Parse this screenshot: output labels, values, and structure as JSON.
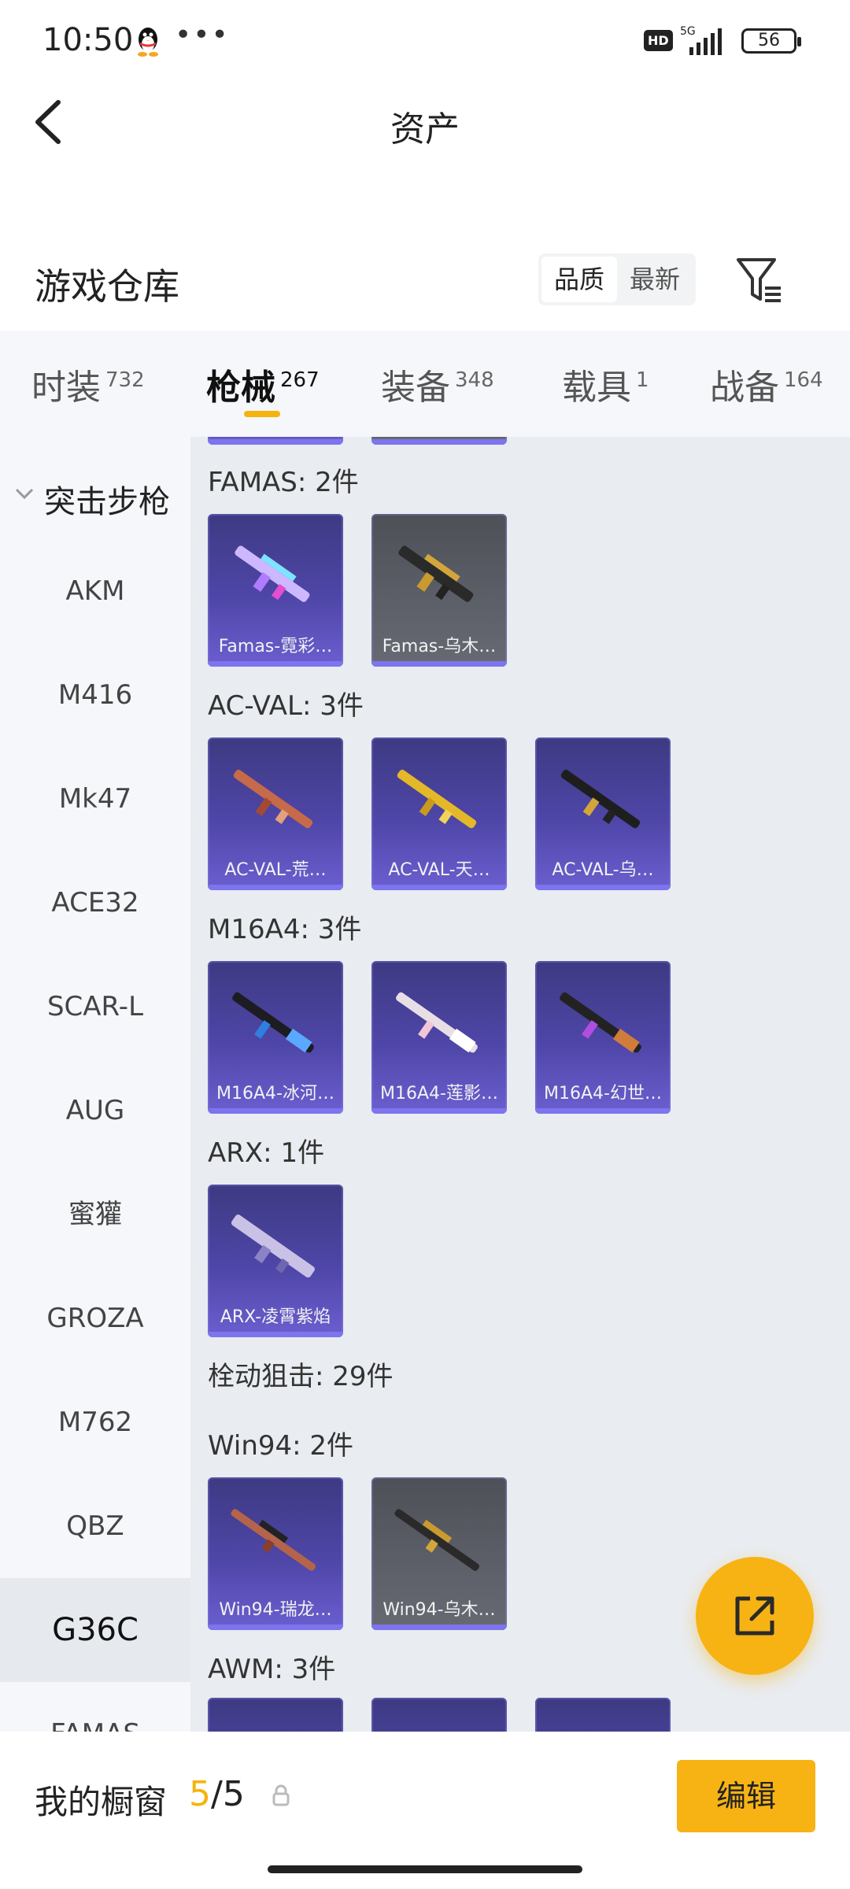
{
  "status_bar": {
    "time": "10:50",
    "network": "5G",
    "hd": "HD",
    "battery": "56",
    "dots": "•••"
  },
  "nav": {
    "title": "资产"
  },
  "warehouse": {
    "title": "游戏仓库",
    "sort_options": [
      "品质",
      "最新"
    ],
    "active_sort": "品质"
  },
  "tabs": [
    {
      "label": "时装",
      "count": "732"
    },
    {
      "label": "枪械",
      "count": "267"
    },
    {
      "label": "装备",
      "count": "348"
    },
    {
      "label": "载具",
      "count": "1"
    },
    {
      "label": "战备",
      "count": "164"
    }
  ],
  "sidebar": {
    "category": "突击步枪",
    "items": [
      "AKM",
      "M416",
      "Mk47",
      "ACE32",
      "SCAR-L",
      "AUG",
      "蜜獾",
      "GROZA",
      "M762",
      "QBZ",
      "G36C",
      "FAMAS"
    ],
    "active": "G36C"
  },
  "groups": [
    {
      "label": "FAMAS: 2件",
      "cards": [
        "Famas-霓彩…",
        "Famas-乌木…"
      ]
    },
    {
      "label": "AC-VAL: 3件",
      "cards": [
        "AC-VAL-荒…",
        "AC-VAL-天…",
        "AC-VAL-乌…"
      ]
    },
    {
      "label": "M16A4: 3件",
      "cards": [
        "M16A4-冰河…",
        "M16A4-莲影…",
        "M16A4-幻世…"
      ]
    },
    {
      "label": "ARX: 1件",
      "cards": [
        "ARX-凌霄紫焰"
      ]
    },
    {
      "label": "栓动狙击: 29件",
      "cards": []
    },
    {
      "label": "Win94: 2件",
      "cards": [
        "Win94-瑞龙…",
        "Win94-乌木…"
      ]
    },
    {
      "label": "AWM: 3件",
      "cards": []
    }
  ],
  "bottom": {
    "title": "我的橱窗",
    "current": "5",
    "separator": "/",
    "total": "5",
    "edit_label": "编辑"
  },
  "colors": {
    "accent": "#f7b314",
    "card_purple": "#4f46a8",
    "card_gray": "#5d6068"
  }
}
